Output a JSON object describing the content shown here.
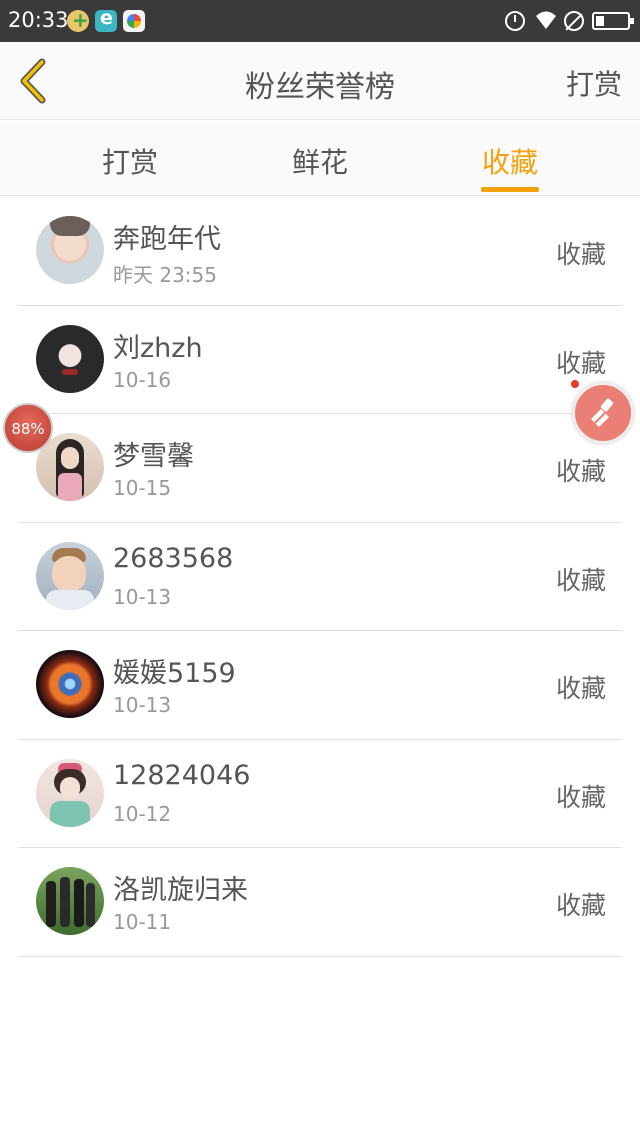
{
  "status_bar": {
    "time": "20:33",
    "icons": [
      "app-plus-icon",
      "browser-e-icon",
      "app-pinwheel-icon",
      "alarm-icon",
      "wifi-icon",
      "do-not-disturb-icon",
      "battery-icon"
    ]
  },
  "header": {
    "title": "粉丝荣誉榜",
    "action_label": "打赏",
    "back_icon": "chevron-left-icon",
    "accent_color": "#f2a20c"
  },
  "tabs": [
    {
      "label": "打赏",
      "active": false
    },
    {
      "label": "鲜花",
      "active": false
    },
    {
      "label": "收藏",
      "active": true
    }
  ],
  "fans": [
    {
      "name": "奔跑年代",
      "date": "昨天 23:55",
      "action": "收藏",
      "avatar": "avatar-photo-boy"
    },
    {
      "name": "刘zhzh",
      "date": "10-16",
      "action": "收藏",
      "avatar": "avatar-photo-girl-dark"
    },
    {
      "name": "梦雪馨",
      "date": "10-15",
      "action": "收藏",
      "avatar": "avatar-photo-girl"
    },
    {
      "name": "2683568",
      "date": "10-13",
      "action": "收藏",
      "avatar": "avatar-photo-child"
    },
    {
      "name": "媛媛5159",
      "date": "10-13",
      "action": "收藏",
      "avatar": "avatar-nebula"
    },
    {
      "name": "12824046",
      "date": "10-12",
      "action": "收藏",
      "avatar": "avatar-painting-lady"
    },
    {
      "name": "洛凯旋归来",
      "date": "10-11",
      "action": "收藏",
      "avatar": "avatar-group-photo"
    }
  ],
  "floating": {
    "progress_label": "88%",
    "clean_icon": "broom-icon"
  }
}
